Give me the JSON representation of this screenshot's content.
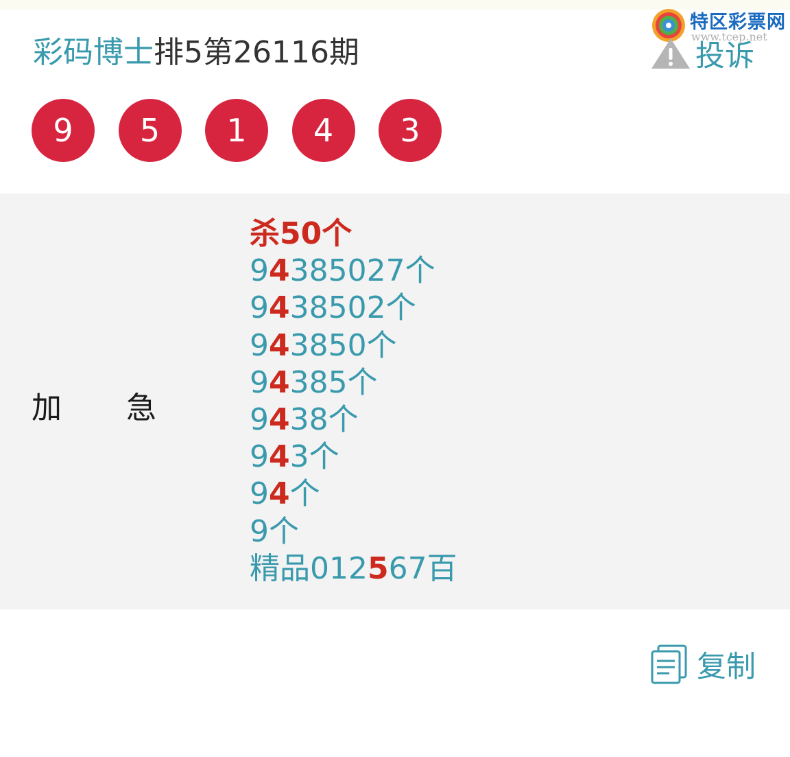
{
  "watermark": {
    "name": "特区彩票网",
    "url": "www.tcep.net",
    "colors": [
      "#f2a22b",
      "#e8433c",
      "#4fb04a",
      "#3d8fd6"
    ]
  },
  "header": {
    "author": "彩码博士",
    "issue_title": "排5第26116期",
    "report_label": "投诉",
    "report_icon": "warning-triangle-icon"
  },
  "draw_numbers": [
    "9",
    "5",
    "1",
    "4",
    "3"
  ],
  "prediction": {
    "label_left": "加",
    "label_right": "急",
    "headline": "杀50个",
    "lines": [
      {
        "a": "9",
        "hl": "4",
        "b": "385027个"
      },
      {
        "a": "9",
        "hl": "4",
        "b": "38502个"
      },
      {
        "a": "9",
        "hl": "4",
        "b": "3850个"
      },
      {
        "a": "9",
        "hl": "4",
        "b": "385个"
      },
      {
        "a": "9",
        "hl": "4",
        "b": "38个"
      },
      {
        "a": "9",
        "hl": "4",
        "b": "3个"
      },
      {
        "a": "9",
        "hl": "4",
        "b": "个"
      },
      {
        "a": "9个",
        "hl": "",
        "b": ""
      },
      {
        "a": "精品012",
        "hl": "5",
        "b": "67百"
      }
    ]
  },
  "footer": {
    "copy_label": "复制",
    "copy_icon": "copy-document-icon"
  },
  "colors": {
    "accent": "#3a9aad",
    "ball": "#d72540",
    "highlight": "#cc2a1e",
    "panel_bg": "#f3f3f3"
  }
}
